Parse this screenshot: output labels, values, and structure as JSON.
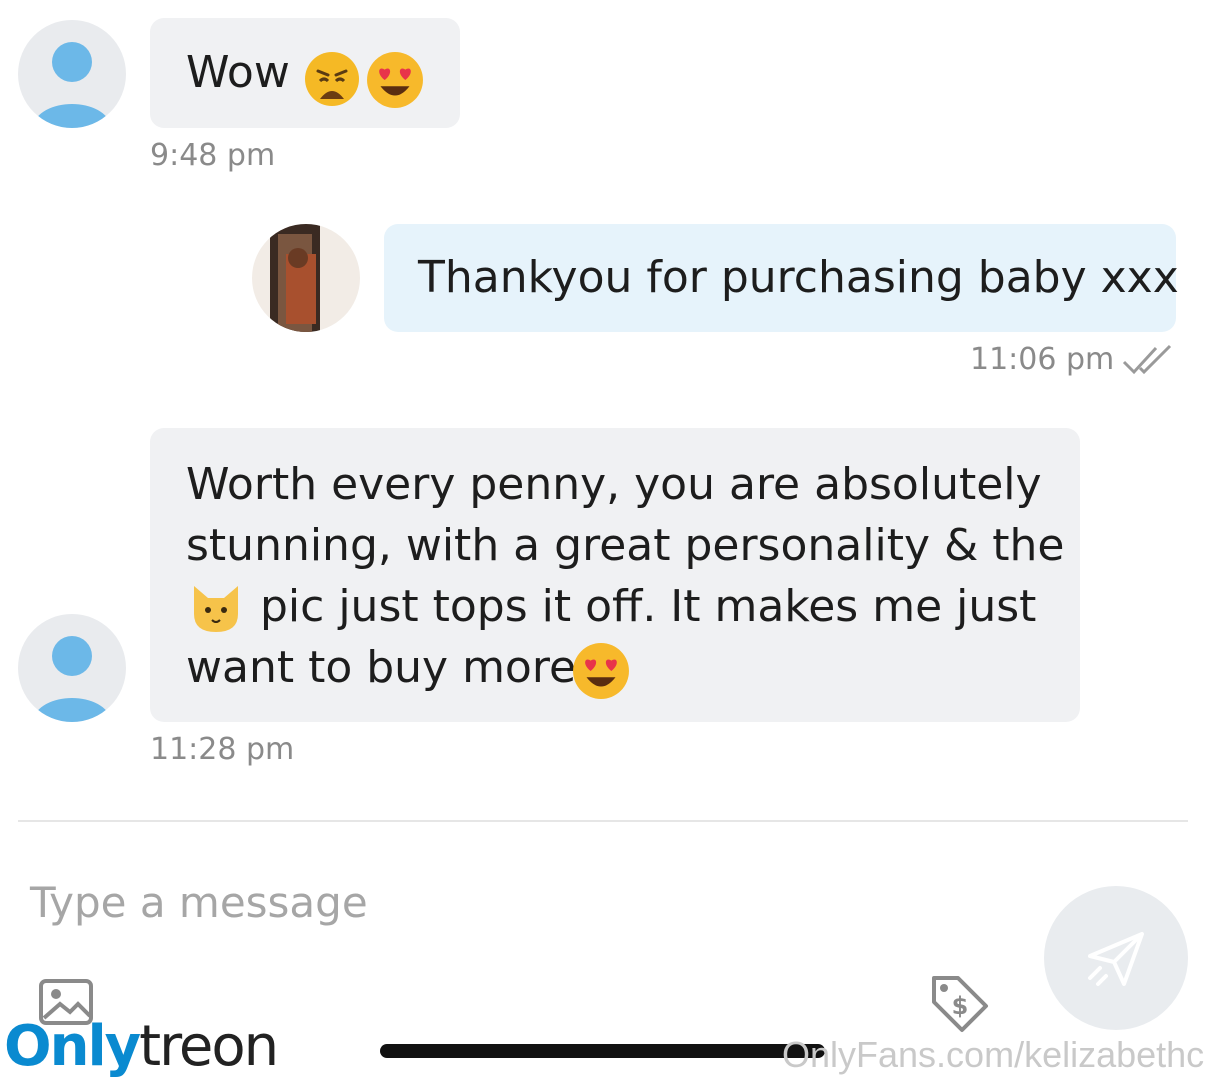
{
  "messages": [
    {
      "text": "Wow",
      "time": "9:48 pm"
    },
    {
      "text": "Thankyou for purchasing baby xxx",
      "time": "11:06 pm"
    },
    {
      "lines": [
        "Worth every penny, you are absolutely",
        "stunning, with a great personality & the",
        "pic just tops it off. It makes me just",
        "want to buy more"
      ],
      "time": "11:28 pm"
    }
  ],
  "composer": {
    "placeholder": "Type a message"
  },
  "logo": {
    "part1": "Only",
    "part2": "treon",
    "color1": "#0a8ad0",
    "color2": "#222222"
  },
  "watermark": "OnlyFans.com/kelizabethc",
  "colors": {
    "incoming_bubble": "#f0f1f3",
    "outgoing_bubble": "#e6f3fb",
    "avatar_blue": "#6cb8e8"
  }
}
